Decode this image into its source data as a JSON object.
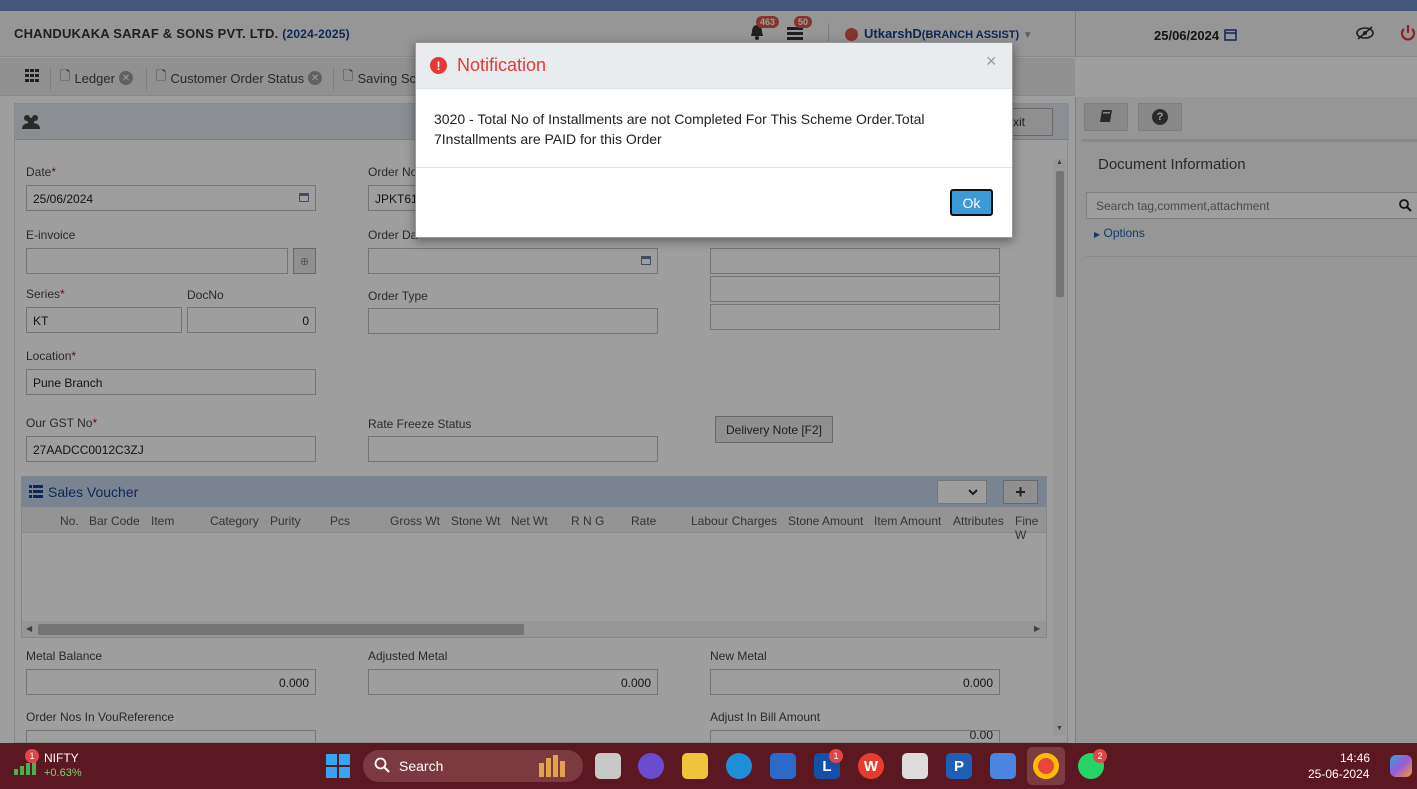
{
  "header": {
    "company": "CHANDUKAKA SARAF & SONS PVT. LTD.",
    "year": "(2024-2025)",
    "notif_count": "463",
    "msg_count": "50",
    "user": "UtkarshD",
    "role": "(BRANCH ASSIST)",
    "date": "25/06/2024"
  },
  "tabs": [
    "Ledger",
    "Customer Order Status",
    "Saving Sc"
  ],
  "form": {
    "date_label": "Date",
    "date_value": "25/06/2024",
    "order_no_label": "Order No",
    "order_no_value": "JPKT61",
    "einvoice_label": "E-invoice",
    "order_date_label": "Order Da",
    "series_label": "Series",
    "series_value": "KT",
    "docno_label": "DocNo",
    "docno_value": "0",
    "order_type_label": "Order Type",
    "location_label": "Location",
    "location_value": "Pune Branch",
    "gst_label": "Our GST No",
    "gst_value": "27AADCC0012C3ZJ",
    "rate_freeze_label": "Rate Freeze Status",
    "delivery_note_btn": "Delivery Note [F2]",
    "exit_btn": "xit",
    "metal_balance_label": "Metal Balance",
    "metal_balance_value": "0.000",
    "adjusted_metal_label": "Adjusted Metal",
    "adjusted_metal_value": "0.000",
    "new_metal_label": "New Metal",
    "new_metal_value": "0.000",
    "order_nos_label": "Order Nos In VouReference",
    "adjust_bill_label": "Adjust In Bill Amount",
    "adjust_bill_value": "0.00"
  },
  "grid": {
    "title": "Sales Voucher",
    "add_label": "+",
    "columns": [
      "No.",
      "Bar Code",
      "Item",
      "Category",
      "Purity",
      "Pcs",
      "Gross Wt",
      "Stone Wt",
      "Net Wt",
      "R N G",
      "Rate",
      "Labour Charges",
      "Stone Amount",
      "Item Amount",
      "Attributes",
      "Fine W"
    ]
  },
  "side": {
    "doc_title": "Document Information",
    "search_placeholder": "Search tag,comment,attachment",
    "options_label": "Options"
  },
  "modal": {
    "title": "Notification",
    "close": "×",
    "message": "3020 - Total No of Installments are not Completed For This Scheme Order.Total 7Installments are PAID for this Order",
    "ok": "Ok"
  },
  "taskbar": {
    "stock_name": "NIFTY",
    "stock_change": "+0.63%",
    "stock_badge": "1",
    "search_label": "Search",
    "time": "14:46",
    "date": "25-06-2024",
    "badge_l": "1",
    "badge_whatsapp": "2"
  },
  "colors": {
    "accent": "#1b3e8a",
    "danger": "#d9534f",
    "ok_button": "#3c9ad8",
    "taskbar": "#5c1820"
  }
}
